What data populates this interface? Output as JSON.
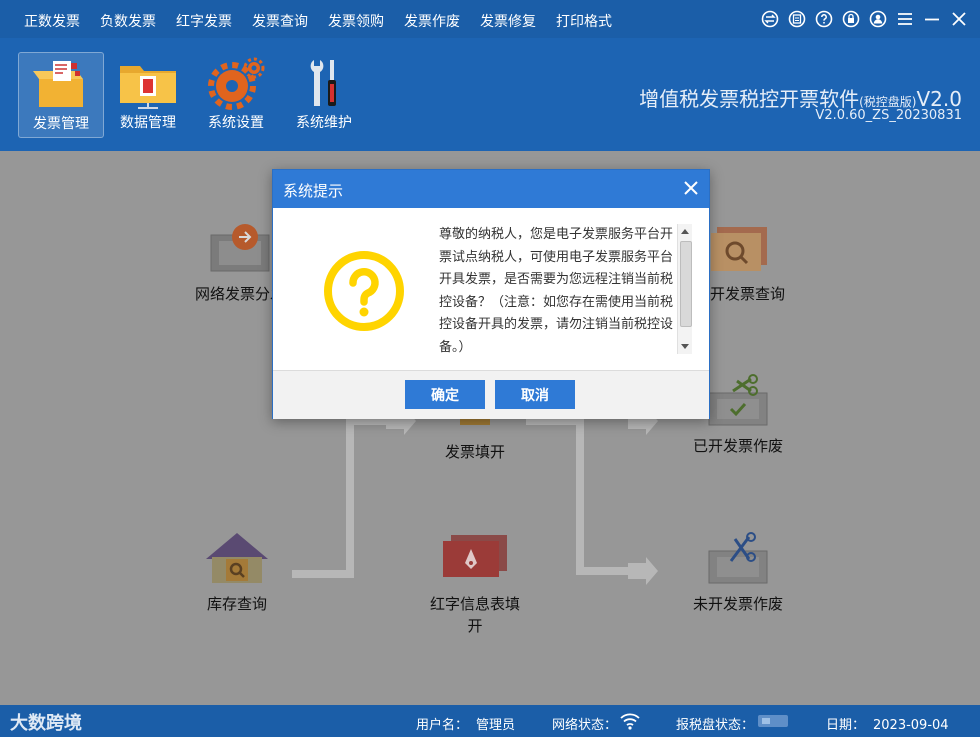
{
  "menu": {
    "items": [
      "正数发票",
      "负数发票",
      "红字发票",
      "发票查询",
      "发票领购",
      "发票作废",
      "发票修复",
      "打印格式"
    ]
  },
  "window_icons": [
    "swap-icon",
    "gift-icon",
    "help-icon",
    "lock-icon",
    "user-icon",
    "menu-icon",
    "minimize-icon",
    "close-icon"
  ],
  "toolbar": {
    "items": [
      {
        "label": "发票管理",
        "icon": "invoice-box-icon",
        "active": true
      },
      {
        "label": "数据管理",
        "icon": "folder-icon",
        "active": false
      },
      {
        "label": "系统设置",
        "icon": "gear-icon",
        "active": false
      },
      {
        "label": "系统维护",
        "icon": "wrench-icon",
        "active": false
      }
    ]
  },
  "app": {
    "title": "增值税发票税控开票软件",
    "edition": "(税控盘版)",
    "title_suffix": "V2.0",
    "version": "V2.0.60_ZS_20230831"
  },
  "flow": {
    "network_invoice": "网络发票分发",
    "issued_query": "已开发票查询",
    "fill_invoice": "发票填开",
    "issued_void": "已开发票作废",
    "stock_query": "库存查询",
    "red_info": "红字信息表填开",
    "unissued_void": "未开发票作废"
  },
  "dialog": {
    "title": "系统提示",
    "message": "尊敬的纳税人，您是电子发票服务平台开票试点纳税人，可使用电子发票服务平台开具发票，是否需要为您远程注销当前税控设备？（注意：如您存在需使用当前税控设备开具的发票，请勿注销当前税控设备。）",
    "ok_label": "确定",
    "cancel_label": "取消"
  },
  "status": {
    "brand": "大数跨境",
    "user_label": "用户名：",
    "user_value": "管理员",
    "network_label": "网络状态：",
    "disk_label": "报税盘状态：",
    "date_label": "日期：",
    "date_value": "2023-09-04"
  },
  "colors": {
    "menubar": "#1b5ea8",
    "toolbar": "#1d64b3",
    "dialog_header": "#2f7ad6",
    "button": "#2f7ad6",
    "question_icon": "#ffd400"
  }
}
